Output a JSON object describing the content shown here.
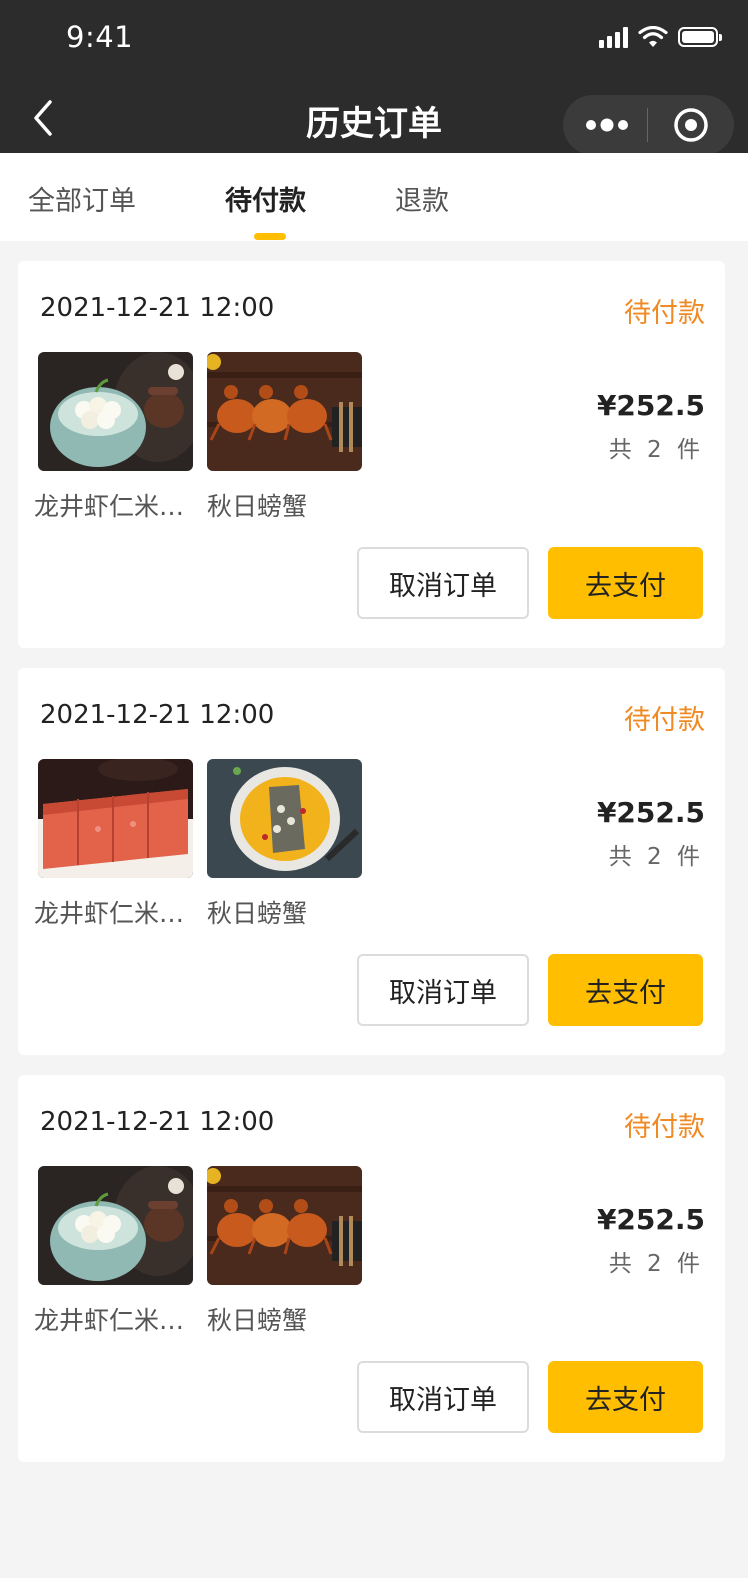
{
  "status_bar": {
    "time": "9:41"
  },
  "nav": {
    "title": "历史订单"
  },
  "tabs": [
    {
      "label": "全部订单"
    },
    {
      "label": "待付款",
      "active": true
    },
    {
      "label": "退款"
    }
  ],
  "colors": {
    "accent": "#ffbe00",
    "status": "#f08a24",
    "topbar": "#2c2c2c"
  },
  "orders": [
    {
      "date": "2021-12-21 12:00",
      "status": "待付款",
      "items": [
        {
          "name": "龙井虾仁米…",
          "image": "lychee-dessert-photo"
        },
        {
          "name": "秋日螃蟹",
          "image": "crab-photo"
        }
      ],
      "price": "¥252.5",
      "count": "共 2 件",
      "cancel_label": "取消订单",
      "pay_label": "去支付"
    },
    {
      "date": "2021-12-21 12:00",
      "status": "待付款",
      "items": [
        {
          "name": "龙井虾仁米…",
          "image": "jujube-cake-photo"
        },
        {
          "name": "秋日螃蟹",
          "image": "soup-bowl-photo"
        }
      ],
      "price": "¥252.5",
      "count": "共 2 件",
      "cancel_label": "取消订单",
      "pay_label": "去支付"
    },
    {
      "date": "2021-12-21 12:00",
      "status": "待付款",
      "items": [
        {
          "name": "龙井虾仁米…",
          "image": "lychee-dessert-photo"
        },
        {
          "name": "秋日螃蟹",
          "image": "crab-photo"
        }
      ],
      "price": "¥252.5",
      "count": "共 2 件",
      "cancel_label": "取消订单",
      "pay_label": "去支付"
    }
  ]
}
